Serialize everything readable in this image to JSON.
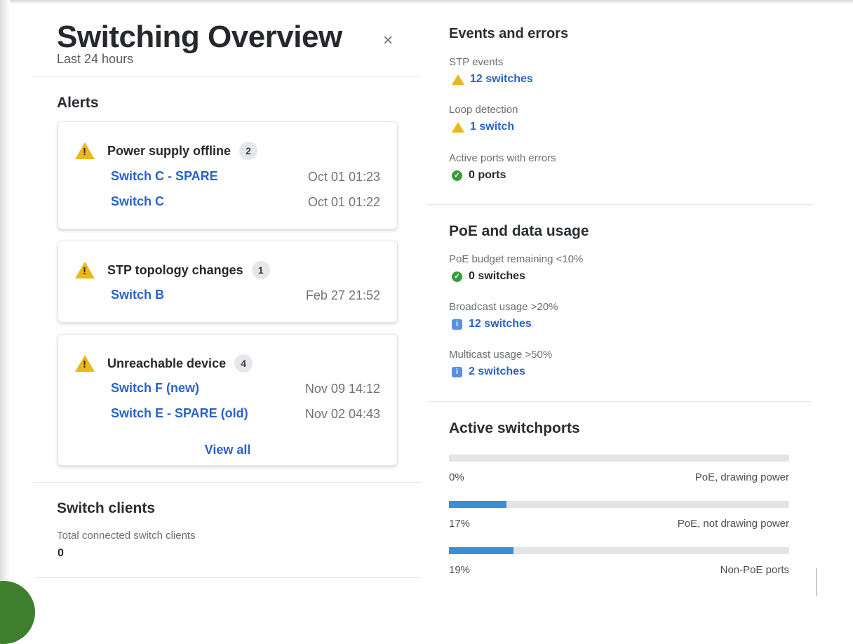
{
  "header": {
    "title": "Switching Overview",
    "subtitle": "Last 24 hours",
    "close_symbol": "×"
  },
  "alerts": {
    "section_title": "Alerts",
    "cards": [
      {
        "title": "Power supply offline",
        "count": "2",
        "icon": "warning-icon",
        "rows": [
          {
            "name": "Switch C - SPARE",
            "time": "Oct 01 01:23"
          },
          {
            "name": "Switch C",
            "time": "Oct 01 01:22"
          }
        ]
      },
      {
        "title": "STP topology changes",
        "count": "1",
        "icon": "warning-icon",
        "rows": [
          {
            "name": "Switch B",
            "time": "Feb 27 21:52"
          }
        ]
      },
      {
        "title": "Unreachable device",
        "count": "4",
        "icon": "warning-icon",
        "rows": [
          {
            "name": "Switch F (new)",
            "time": "Nov 09 14:12"
          },
          {
            "name": "Switch E - SPARE (old)",
            "time": "Nov 02 04:43"
          }
        ],
        "view_all": "View all"
      }
    ]
  },
  "switch_clients": {
    "section_title": "Switch clients",
    "label": "Total connected switch clients",
    "value": "0"
  },
  "events": {
    "section_title": "Events and errors",
    "items": [
      {
        "label": "STP events",
        "value": "12 switches",
        "icon": "warning-icon",
        "status": "warning"
      },
      {
        "label": "Loop detection",
        "value": "1 switch",
        "icon": "warning-icon",
        "status": "warning"
      },
      {
        "label": "Active ports with errors",
        "value": "0 ports",
        "icon": "check-icon",
        "status": "ok"
      }
    ]
  },
  "poe": {
    "section_title": "PoE and data usage",
    "items": [
      {
        "label": "PoE budget remaining <10%",
        "value": "0 switches",
        "icon": "check-icon",
        "status": "ok"
      },
      {
        "label": "Broadcast usage >20%",
        "value": "12 switches",
        "icon": "info-icon",
        "status": "info"
      },
      {
        "label": "Multicast usage >50%",
        "value": "2 switches",
        "icon": "info-icon",
        "status": "info"
      }
    ]
  },
  "active_switchports": {
    "section_title": "Active switchports",
    "bars": [
      {
        "percent_label": "0%",
        "fill_fraction": 0.0,
        "label": "PoE, drawing power"
      },
      {
        "percent_label": "17%",
        "fill_fraction": 0.17,
        "label": "PoE, not drawing power"
      },
      {
        "percent_label": "19%",
        "fill_fraction": 0.19,
        "label": "Non-PoE ports"
      }
    ]
  },
  "colors": {
    "link": "#2a62c8",
    "warning": "#e8b81c",
    "ok": "#3a9b3a",
    "info": "#5b8fe0",
    "bar_fill": "#3b8fd6",
    "bar_track": "#e2e4e6"
  }
}
